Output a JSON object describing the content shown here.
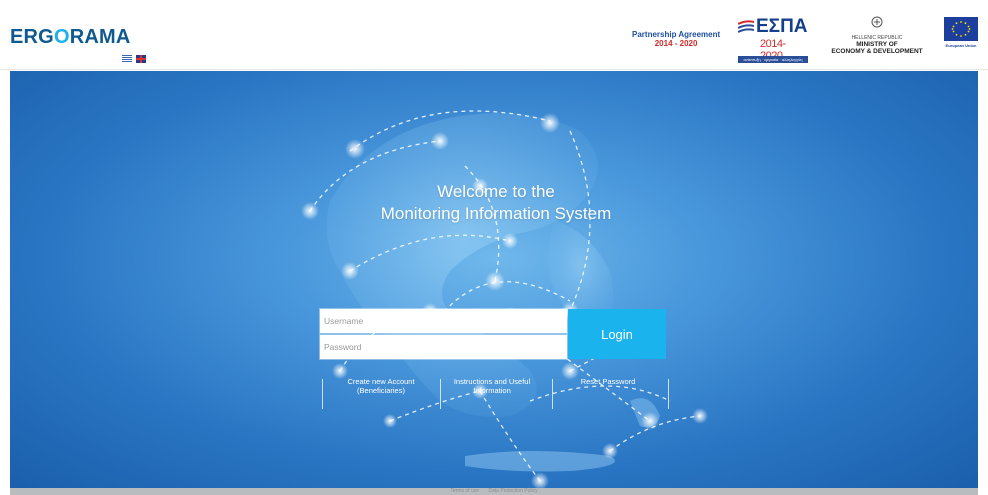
{
  "header": {
    "brand": {
      "prefix": "ERG",
      "middle": "O",
      "suffix": "RAMA"
    },
    "partnership": {
      "line1": "Partnership Agreement",
      "line2": "2014 - 2020"
    },
    "espa": {
      "title": "ΕΣΠΑ",
      "years": "2014-2020",
      "tagline": "ανάπτυξη · εργασία · αλληλεγγύη"
    },
    "ministry": {
      "republic": "HELLENIC REPUBLIC",
      "line1": "MINISTRY OF",
      "line2": "ECONOMY & DEVELOPMENT"
    },
    "eu": {
      "label": "European Union"
    }
  },
  "hero": {
    "welcome_line1": "Welcome to the",
    "welcome_line2": "Monitoring Information System"
  },
  "login": {
    "username_placeholder": "Username",
    "password_placeholder": "Password",
    "login_label": "Login"
  },
  "links": {
    "create_account": "Create new Account (Beneficiaries)",
    "instructions": "Instructions and Useful Information",
    "reset_password": "Reset Password"
  },
  "footer": {
    "terms": "Terms of use",
    "privacy": "Data Protection Policy"
  },
  "colors": {
    "brand_blue": "#0f5a8f",
    "brand_accent": "#1ab2e8",
    "login_button": "#1bb3ee",
    "hero_background": "#2a76c4"
  }
}
